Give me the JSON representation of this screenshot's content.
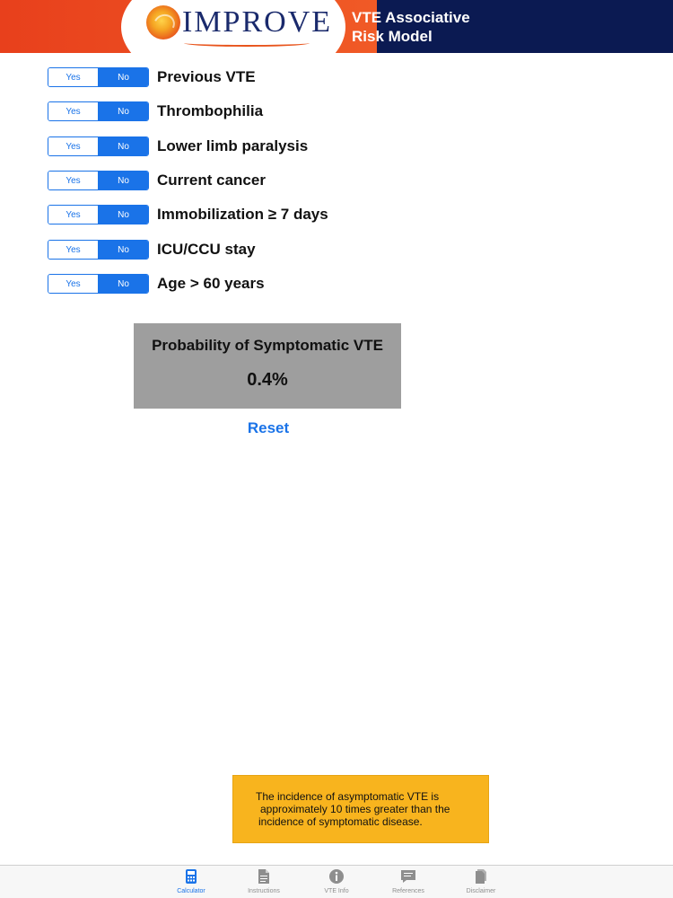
{
  "header": {
    "logo_text": "IMPROVE",
    "title_line1": "VTE Associative",
    "title_line2": "Risk Model"
  },
  "toggle": {
    "yes_label": "Yes",
    "no_label": "No"
  },
  "factors": [
    {
      "label": "Previous VTE",
      "selected": "No"
    },
    {
      "label": "Thrombophilia",
      "selected": "No"
    },
    {
      "label": "Lower limb paralysis",
      "selected": "No"
    },
    {
      "label": "Current cancer",
      "selected": "No"
    },
    {
      "label": "Immobilization ≥ 7 days",
      "selected": "No"
    },
    {
      "label": "ICU/CCU stay",
      "selected": "No"
    },
    {
      "label": "Age > 60 years",
      "selected": "No"
    }
  ],
  "result": {
    "title": "Probability of Symptomatic VTE",
    "value": "0.4%"
  },
  "reset_label": "Reset",
  "note": {
    "lines": [
      "The incidence of asymptomatic VTE is",
      "approximately 10 times greater than the",
      "incidence of symptomatic disease."
    ]
  },
  "tabs": [
    {
      "label": "Calculator",
      "icon": "calculator-icon",
      "active": true
    },
    {
      "label": "Instructions",
      "icon": "document-icon",
      "active": false
    },
    {
      "label": "VTE Info",
      "icon": "info-icon",
      "active": false
    },
    {
      "label": "References",
      "icon": "speech-bubble-icon",
      "active": false
    },
    {
      "label": "Disclaimer",
      "icon": "documents-icon",
      "active": false
    }
  ],
  "colors": {
    "accent": "#1a73e8",
    "header_navy": "#0b1a52",
    "header_orange": "#e8401c",
    "result_gray": "#9e9e9e",
    "note_yellow": "#f8b41e"
  }
}
